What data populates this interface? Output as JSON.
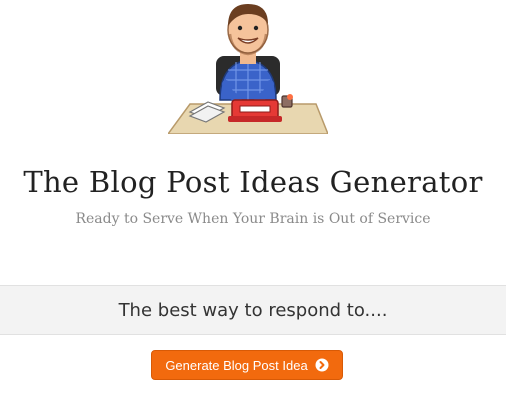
{
  "header": {
    "title": "The Blog Post Ideas Generator",
    "subtitle": "Ready to Serve When Your Brain is Out of Service"
  },
  "idea": {
    "text": "The best way to respond to...."
  },
  "generate_button": {
    "label": "Generate Blog Post Idea",
    "icon": "chevron-circle-right-icon"
  },
  "colors": {
    "accent": "#f26a0e",
    "band_bg": "#f3f3f3"
  }
}
